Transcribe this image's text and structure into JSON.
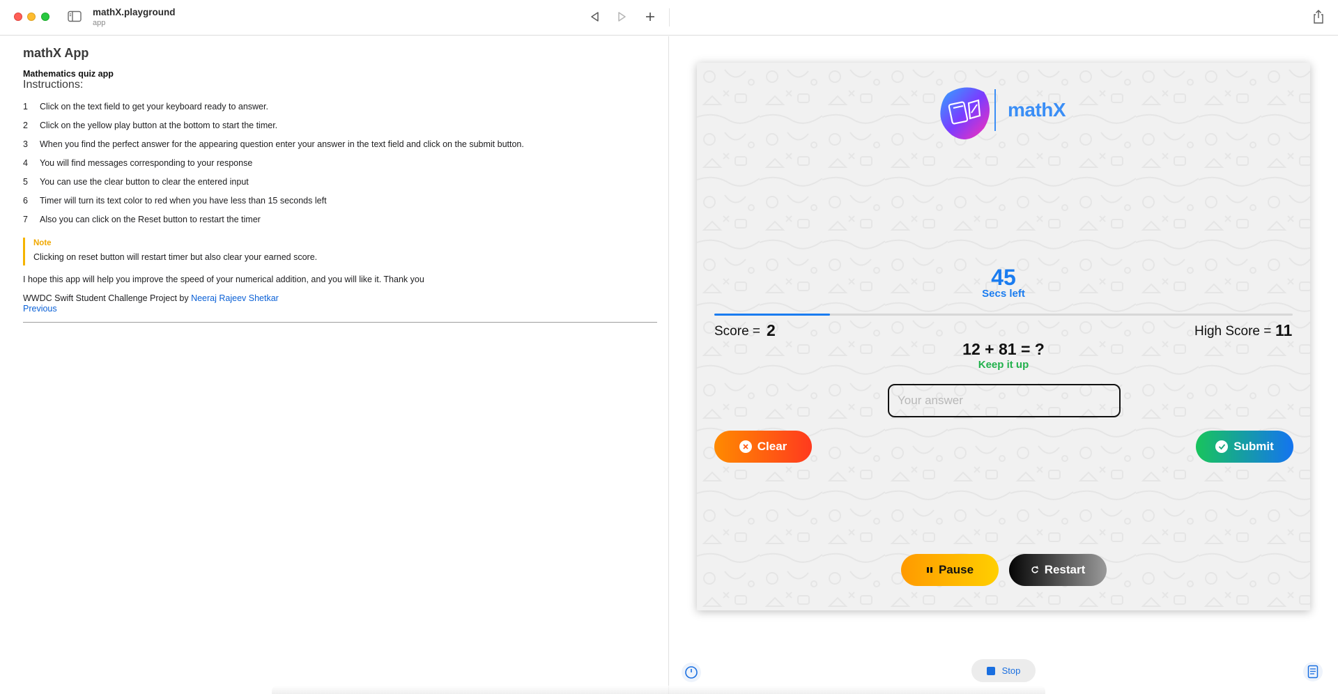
{
  "titlebar": {
    "title": "mathX.playground",
    "subtitle": "app"
  },
  "doc": {
    "heading": "mathX App",
    "subtitle": "Mathematics quiz app",
    "instructions_heading": "Instructions:",
    "steps": [
      {
        "num": "1",
        "text": "Click on the text field to get your keyboard ready to answer."
      },
      {
        "num": "2",
        "text": "Click on the yellow play button at the bottom to start the timer."
      },
      {
        "num": "3",
        "text": "When you find the perfect answer for the appearing question enter your answer in the text field and click on the submit button."
      },
      {
        "num": "4",
        "text": "You will find messages corresponding to your response"
      },
      {
        "num": "5",
        "text": "You can use the clear button to clear the entered input"
      },
      {
        "num": "6",
        "text": "Timer will turn its text color to red when you have less than 15 seconds left"
      },
      {
        "num": "7",
        "text": "Also you can click on the Reset button to restart the timer"
      }
    ],
    "note_title": "Note",
    "note_text": "Clicking on reset button will restart timer but also clear your earned score.",
    "thanks": "I hope this app will help you improve the speed of your numerical addition, and you will like it. Thank you",
    "credit_prefix": "WWDC Swift Student Challenge Project by ",
    "credit_link": "Neeraj Rajeev Shetkar",
    "previous": "Previous"
  },
  "app": {
    "brand": "mathX",
    "timer": "45",
    "timer_label": "Secs left",
    "timer_progress": 0.2,
    "score_label": "Score =",
    "score_value": "2",
    "high_score_label": "High Score =",
    "high_score_value": "11",
    "question": "12 + 81 = ?",
    "feedback": "Keep it up",
    "answer_placeholder": "Your answer",
    "answer_value": "",
    "clear_label": "Clear",
    "submit_label": "Submit",
    "pause_label": "Pause",
    "restart_label": "Restart",
    "colors": {
      "accent": "#1a7cf0",
      "feedback": "#22b14c",
      "note": "#f5b400"
    }
  },
  "bottom": {
    "stop_label": "Stop"
  }
}
